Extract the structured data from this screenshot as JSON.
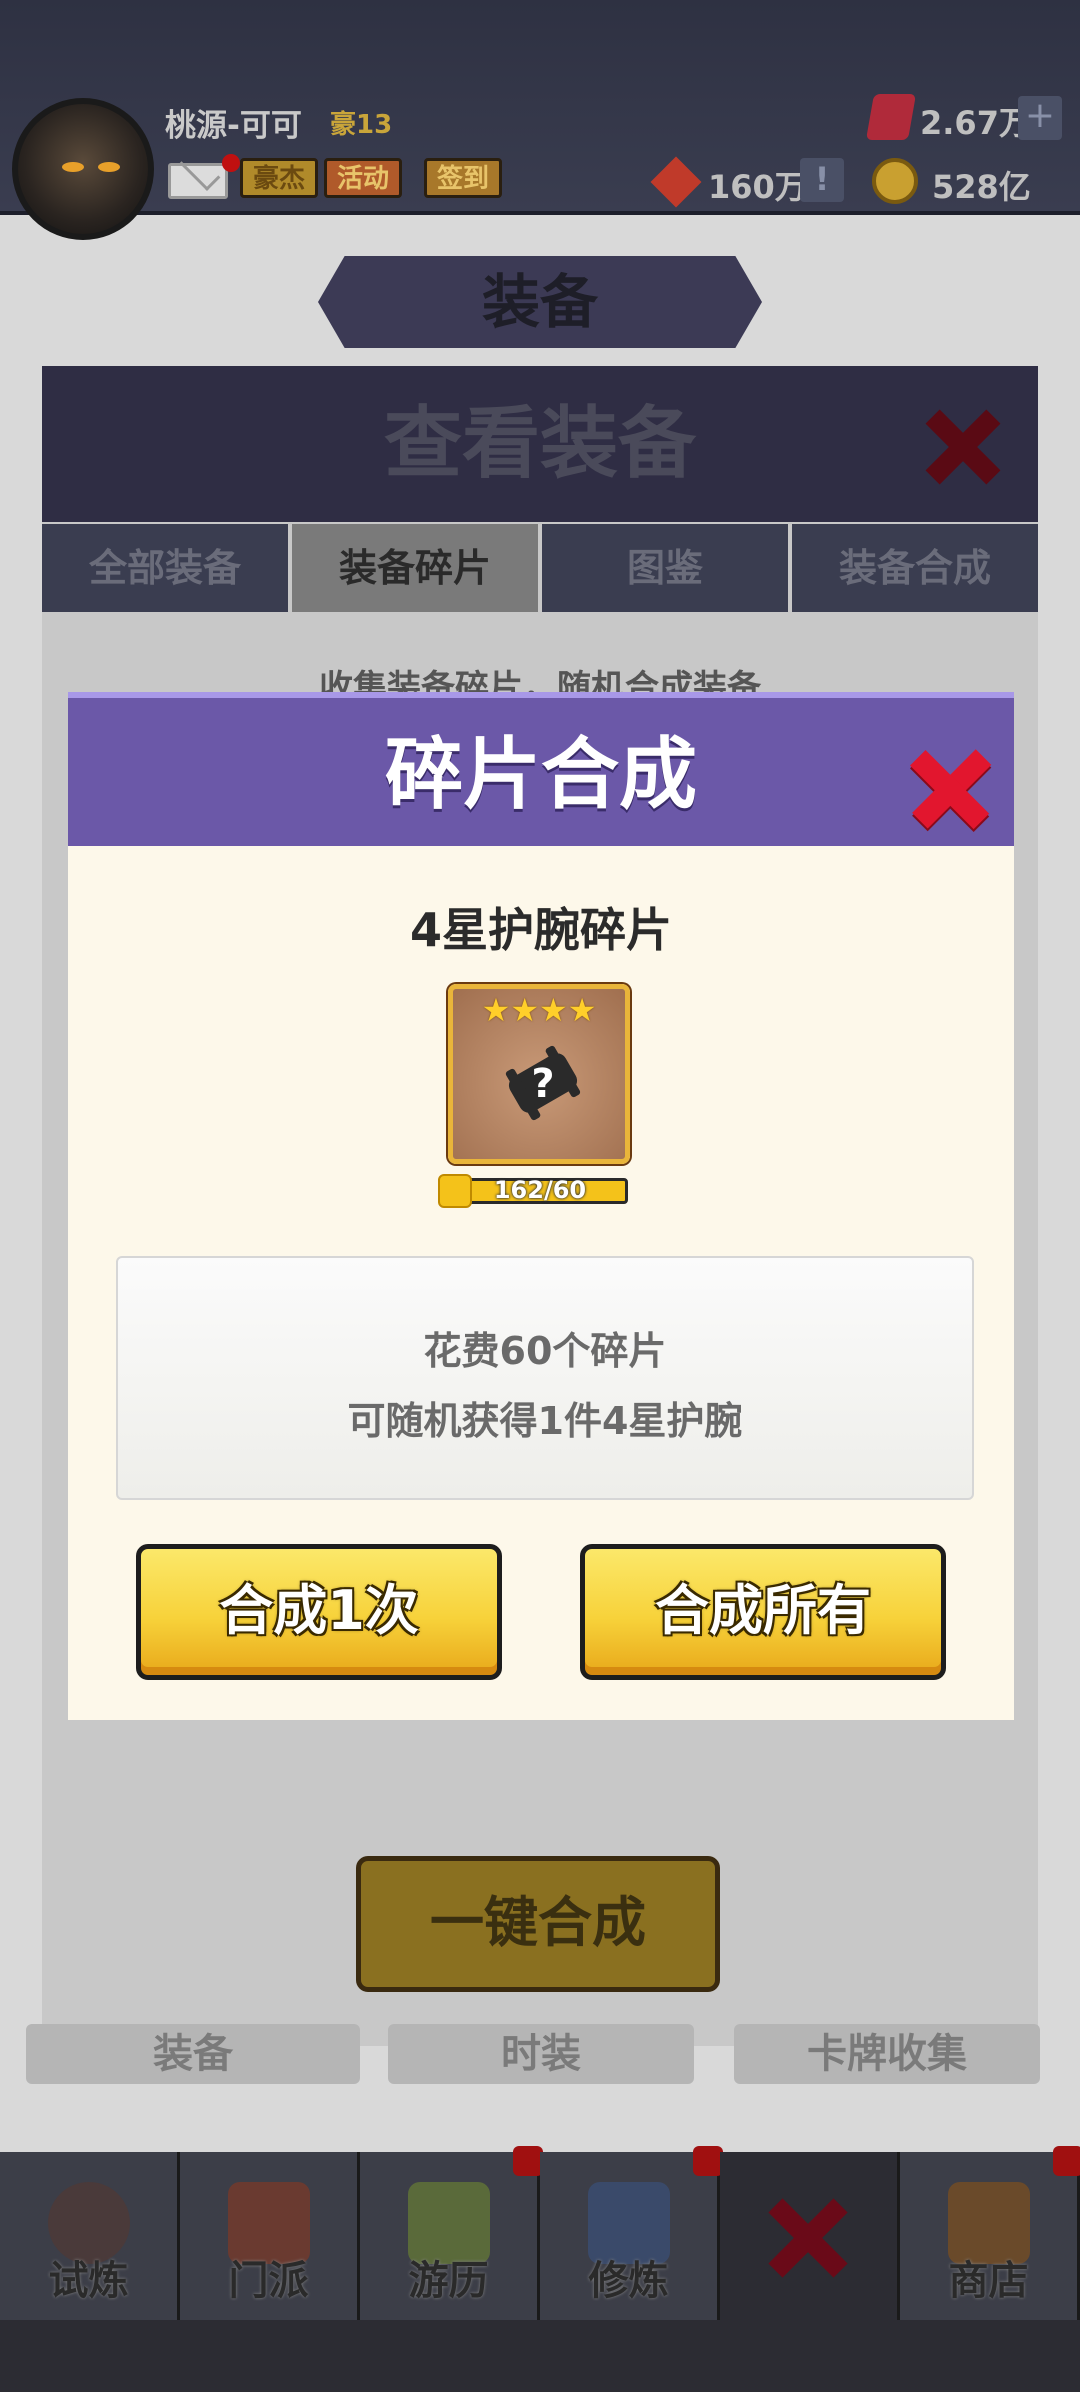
{
  "topbar": {
    "player_name": "桃源-可可",
    "rank": "豪13",
    "badges": [
      "豪杰",
      "活动",
      "签到"
    ],
    "gems": "2.67万",
    "tickets": "160万",
    "gold": "528亿",
    "plus_label": "+",
    "info_label": "!"
  },
  "equip": {
    "banner": "装备",
    "panel_title": "查看装备",
    "tabs": [
      "全部装备",
      "装备碎片",
      "图鉴",
      "装备合成"
    ],
    "hint": "收集装备碎片，随机合成装备",
    "one_click": "一键合成",
    "sub_tabs": [
      "装备",
      "时装",
      "卡牌收集"
    ]
  },
  "bottom_nav": [
    "试炼",
    "门派",
    "游历",
    "修炼",
    "",
    "商店"
  ],
  "modal": {
    "title": "碎片合成",
    "item_name": "4星护腕碎片",
    "stars": "★★★★",
    "fragments": "162/60",
    "desc_line1": "花费60个碎片",
    "desc_line2": "可随机获得1件4星护腕",
    "btn_one": "合成1次",
    "btn_all": "合成所有"
  },
  "colors": {
    "modal_header": "#6b58a8",
    "modal_body": "#fdf8ea",
    "button_yellow": "#f7d23a",
    "close_red": "#d0102a"
  },
  "icons": [
    "avatar",
    "mail-icon",
    "gem-icon",
    "ticket-icon",
    "gold-coin-icon",
    "close-icon",
    "bracer-icon",
    "puzzle-icon"
  ]
}
